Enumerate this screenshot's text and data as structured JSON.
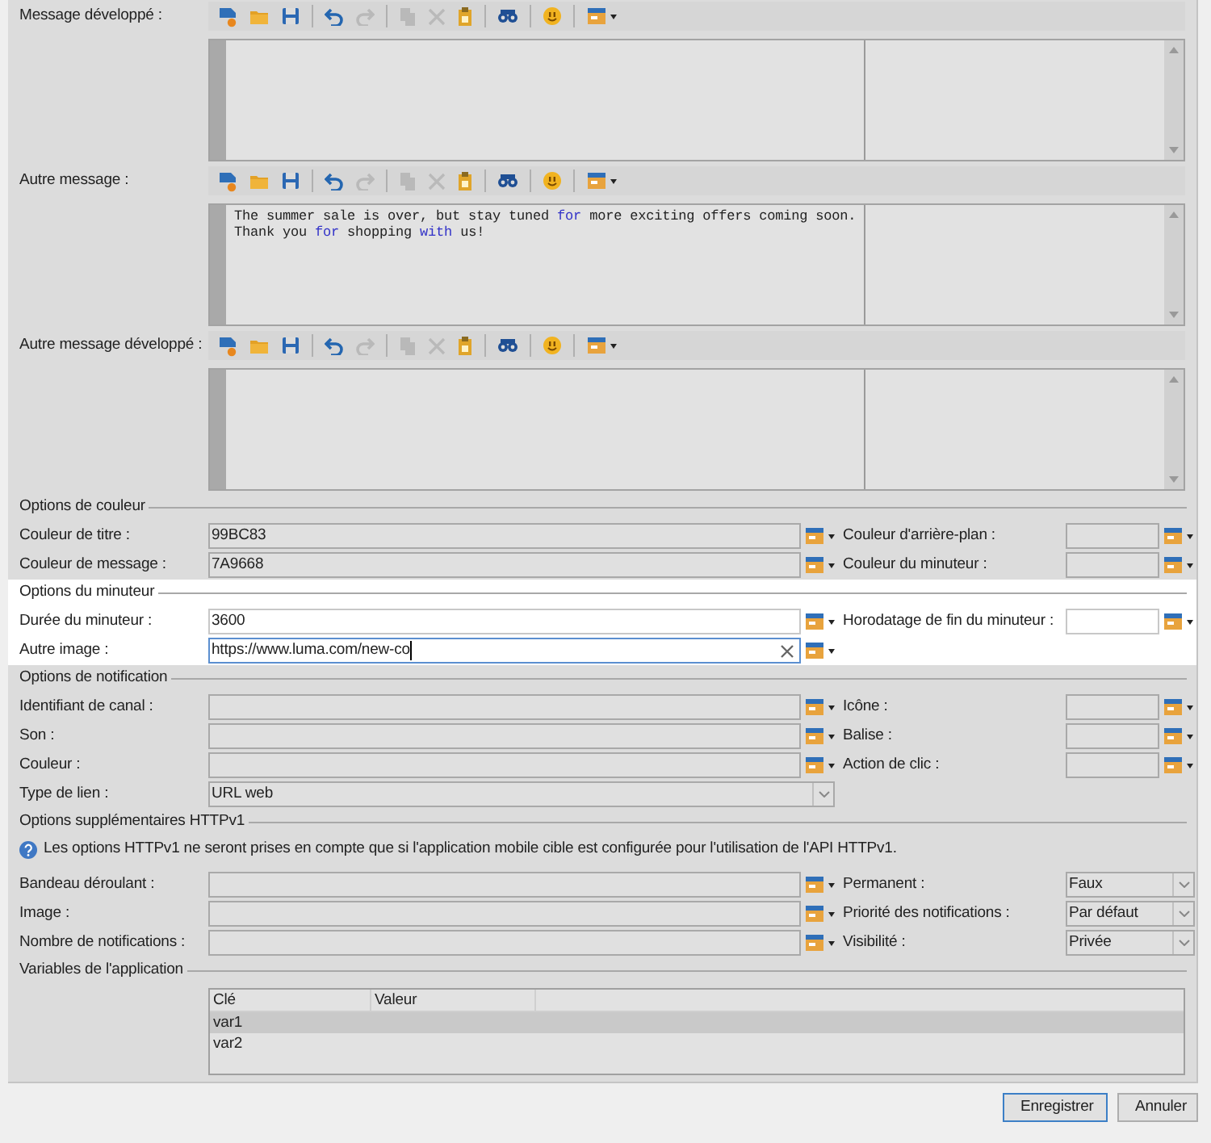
{
  "editors": [
    {
      "label": "Message développé :",
      "toolbar": [
        {
          "kind": "new",
          "disabled": false
        },
        {
          "kind": "open",
          "disabled": false
        },
        {
          "kind": "save",
          "disabled": false
        },
        {
          "kind": "undo",
          "disabled": false
        },
        {
          "kind": "redo",
          "disabled": true
        },
        {
          "kind": "copy",
          "disabled": true
        },
        {
          "kind": "cut",
          "disabled": true
        },
        {
          "kind": "paste",
          "disabled": false
        },
        {
          "kind": "find",
          "disabled": false
        },
        {
          "kind": "emoji",
          "disabled": false
        },
        {
          "kind": "insert",
          "disabled": false
        }
      ]
    },
    {
      "label": "Autre message :",
      "toolbar": [
        {
          "kind": "new",
          "disabled": false
        },
        {
          "kind": "open",
          "disabled": false
        },
        {
          "kind": "save",
          "disabled": false
        },
        {
          "kind": "undo",
          "disabled": false
        },
        {
          "kind": "redo",
          "disabled": true
        },
        {
          "kind": "copy",
          "disabled": true
        },
        {
          "kind": "cut",
          "disabled": true
        },
        {
          "kind": "paste",
          "disabled": false
        },
        {
          "kind": "find",
          "disabled": false
        },
        {
          "kind": "emoji",
          "disabled": false
        },
        {
          "kind": "insert",
          "disabled": false
        }
      ],
      "lines": [
        [
          {
            "kind": "plain",
            "text": "The summer sale is over, but stay tuned "
          },
          {
            "kind": "keyword",
            "text": "for"
          },
          {
            "kind": "plain",
            "text": " more exciting offers coming soon."
          }
        ],
        [
          {
            "kind": "plain",
            "text": "Thank you "
          },
          {
            "kind": "keyword",
            "text": "for"
          },
          {
            "kind": "plain",
            "text": " shopping "
          },
          {
            "kind": "keyword",
            "text": "with"
          },
          {
            "kind": "plain",
            "text": " us!"
          }
        ]
      ]
    },
    {
      "label": "Autre message développé :",
      "toolbar": [
        {
          "kind": "new",
          "disabled": false
        },
        {
          "kind": "open",
          "disabled": false
        },
        {
          "kind": "save",
          "disabled": false
        },
        {
          "kind": "undo",
          "disabled": false
        },
        {
          "kind": "redo",
          "disabled": true
        },
        {
          "kind": "copy",
          "disabled": true
        },
        {
          "kind": "cut",
          "disabled": true
        },
        {
          "kind": "paste",
          "disabled": false
        },
        {
          "kind": "find",
          "disabled": false
        },
        {
          "kind": "emoji",
          "disabled": false
        },
        {
          "kind": "insert",
          "disabled": false
        }
      ]
    }
  ],
  "sections": [
    {
      "title": "Options de couleur",
      "highlighted": false,
      "rows": [
        {
          "left": {
            "label": "Couleur de titre :",
            "kind": "text",
            "value": "99BC83",
            "focused": false
          },
          "right": {
            "label": "Couleur d'arrière-plan :",
            "kind": "text",
            "focused": false
          }
        },
        {
          "left": {
            "label": "Couleur de message :",
            "kind": "text",
            "value": "7A9668",
            "focused": false
          },
          "right": {
            "label": "Couleur du minuteur :",
            "kind": "text",
            "focused": false
          }
        }
      ]
    },
    {
      "title": "Options du minuteur",
      "highlighted": true,
      "rows": [
        {
          "left": {
            "label": "Durée du minuteur :",
            "kind": "text",
            "value": "3600",
            "focused": false
          },
          "right": {
            "label": "Horodatage de fin du minuteur :",
            "kind": "text",
            "focused": false
          }
        },
        {
          "left": {
            "label": "Autre image :",
            "kind": "text",
            "value": "https://www.luma.com/new-co",
            "focused": true
          }
        }
      ]
    },
    {
      "title": "Options de notification",
      "highlighted": false,
      "rows": [
        {
          "left": {
            "label": "Identifiant de canal :",
            "kind": "text",
            "focused": false
          },
          "right": {
            "label": "Icône :",
            "kind": "text",
            "focused": false
          }
        },
        {
          "left": {
            "label": "Son :",
            "kind": "text",
            "focused": false
          },
          "right": {
            "label": "Balise :",
            "kind": "text",
            "focused": false
          }
        },
        {
          "left": {
            "label": "Couleur :",
            "kind": "text",
            "focused": false
          },
          "right": {
            "label": "Action de clic :",
            "kind": "text",
            "focused": false
          }
        },
        {
          "left": {
            "label": "Type de lien :",
            "kind": "select",
            "value": "URL web"
          }
        }
      ]
    },
    {
      "title": "Options supplémentaires HTTPv1",
      "highlighted": false,
      "info": "Les options HTTPv1 ne seront prises en compte que si l'application mobile cible est configurée pour l'utilisation de l'API HTTPv1.",
      "rows": [
        {
          "left": {
            "label": "Bandeau déroulant :",
            "kind": "text",
            "focused": false
          },
          "right": {
            "label": "Permanent :",
            "kind": "select",
            "value": "Faux"
          }
        },
        {
          "left": {
            "label": "Image :",
            "kind": "text",
            "focused": false
          },
          "right": {
            "label": "Priorité des notifications :",
            "kind": "select",
            "value": "Par défaut"
          }
        },
        {
          "left": {
            "label": "Nombre de notifications :",
            "kind": "text",
            "focused": false
          },
          "right": {
            "label": "Visibilité :",
            "kind": "select",
            "value": "Privée"
          }
        }
      ]
    }
  ],
  "variables": {
    "title": "Variables de l'application",
    "columns": [
      "Clé",
      "Valeur"
    ],
    "rows": [
      {
        "key": "var1",
        "selected": true
      },
      {
        "key": "var2",
        "selected": false
      }
    ]
  },
  "buttons": [
    {
      "label": "Enregistrer",
      "default": true
    },
    {
      "label": "Annuler",
      "default": false
    }
  ]
}
